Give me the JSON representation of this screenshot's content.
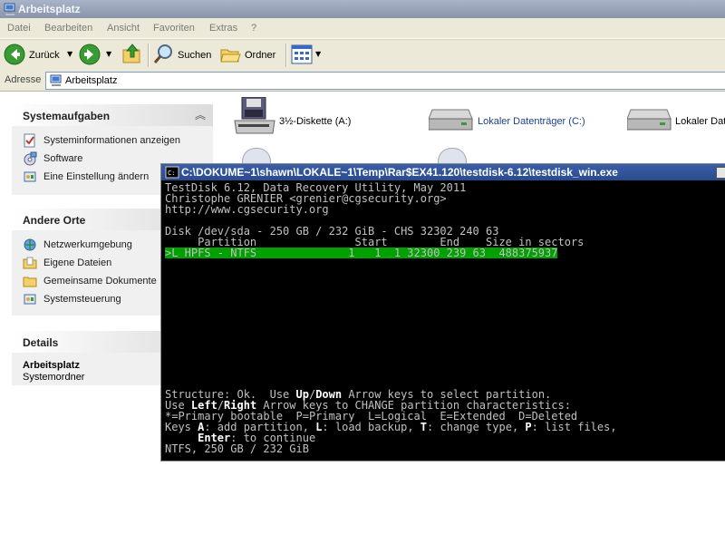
{
  "window": {
    "title": "Arbeitsplatz"
  },
  "menu": [
    "Datei",
    "Bearbeiten",
    "Ansicht",
    "Favoriten",
    "Extras",
    "?"
  ],
  "toolbar": {
    "back": "Zurück",
    "search": "Suchen",
    "folders": "Ordner"
  },
  "address": {
    "label": "Adresse",
    "value": "Arbeitsplatz"
  },
  "tasks": {
    "system": {
      "title": "Systemaufgaben",
      "items": [
        "Systeminformationen anzeigen",
        "Software",
        "Eine Einstellung ändern"
      ]
    },
    "places": {
      "title": "Andere Orte",
      "items": [
        "Netzwerkumgebung",
        "Eigene Dateien",
        "Gemeinsame Dokumente",
        "Systemsteuerung"
      ]
    },
    "details": {
      "title": "Details",
      "name": "Arbeitsplatz",
      "type": "Systemordner"
    }
  },
  "drives": [
    "3½-Diskette (A:)",
    "Lokaler Datenträger (C:)",
    "Lokaler Dat"
  ],
  "console": {
    "title": "C:\\DOKUME~1\\shawn\\LOKALE~1\\Temp\\Rar$EX41.120\\testdisk-6.12\\testdisk_win.exe",
    "lines": [
      "TestDisk 6.12, Data Recovery Utility, May 2011",
      "Christophe GRENIER <grenier@cgsecurity.org>",
      "http://www.cgsecurity.org",
      "",
      "Disk /dev/sda - 250 GB / 232 GiB - CHS 32302 240 63",
      "     Partition               Start        End    Size in sectors",
      ">L HPFS - NTFS              1   1  1 32300 239 63  488375937"
    ],
    "footer": {
      "l1a": "Structure: Ok.  Use ",
      "l1b": "Up",
      "l1c": "/",
      "l1d": "Down",
      "l1e": " Arrow keys to select partition.",
      "l2a": "Use ",
      "l2b": "Left",
      "l2c": "/",
      "l2d": "Right",
      "l2e": " Arrow keys to CHANGE partition characteristics:",
      "l3": "*=Primary bootable  P=Primary  L=Logical  E=Extended  D=Deleted",
      "l4a": "Keys ",
      "l4b": "A",
      "l4c": ": add partition, ",
      "l4d": "L",
      "l4e": ": load backup, ",
      "l4f": "T",
      "l4g": ": change type, ",
      "l4h": "P",
      "l4i": ": list files,",
      "l5a": "     ",
      "l5b": "Enter",
      "l5c": ": to continue",
      "l6": "NTFS, 250 GB / 232 GiB"
    }
  }
}
